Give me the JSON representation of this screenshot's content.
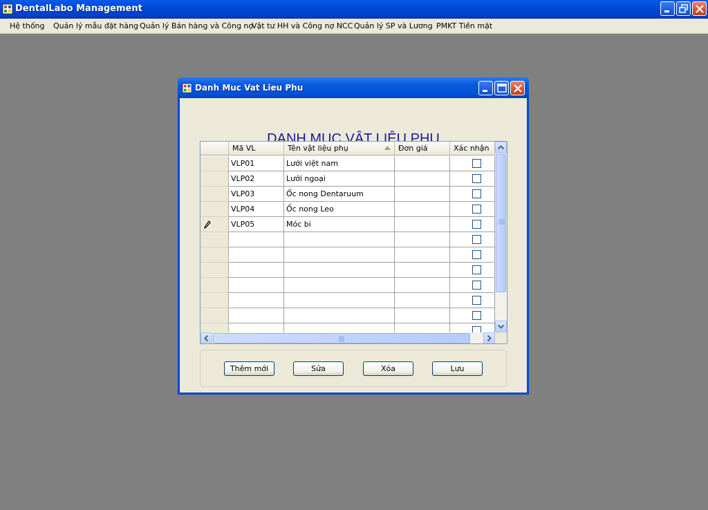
{
  "app": {
    "title": "DentalLabo Management"
  },
  "menu": [
    {
      "label": "Hệ thống"
    },
    {
      "label": "Quản lý mẫu đặt hàng"
    },
    {
      "label": "Quản lý Bán hàng và Công nợ"
    },
    {
      "label": "Vật tư HH và Công nợ NCC"
    },
    {
      "label": "Quản lý SP và Lương"
    },
    {
      "label": "PMKT Tiền mặt"
    }
  ],
  "child_window": {
    "title": "Danh Muc Vat Lieu Phu",
    "heading": "DANH MỤC VẬT LIỆU PHỤ"
  },
  "grid": {
    "columns": [
      "Mã VL",
      "Tên vật liệu phụ",
      "Đơn giá",
      "Xác nhận"
    ],
    "sort_column": "Tên vật liệu phụ",
    "rows": [
      {
        "code": "VLP01",
        "name": "Lưới việt nam",
        "price": "",
        "confirmed": false
      },
      {
        "code": "VLP02",
        "name": "Lưới ngoại",
        "price": "",
        "confirmed": false
      },
      {
        "code": "VLP03",
        "name": "Ốc nong Dentaruum",
        "price": "",
        "confirmed": false
      },
      {
        "code": "VLP04",
        "name": "Ốc nong Leo",
        "price": "",
        "confirmed": false
      },
      {
        "code": "VLP05",
        "name": "Móc bi",
        "price": "",
        "confirmed": false,
        "editing": true
      }
    ],
    "empty_rows": 7
  },
  "buttons": {
    "add": "Thêm mới",
    "edit": "Sửa",
    "delete": "Xóa",
    "save": "Lưu"
  },
  "icons": {
    "app": "app-icon",
    "editing_row": "pencil-icon"
  }
}
